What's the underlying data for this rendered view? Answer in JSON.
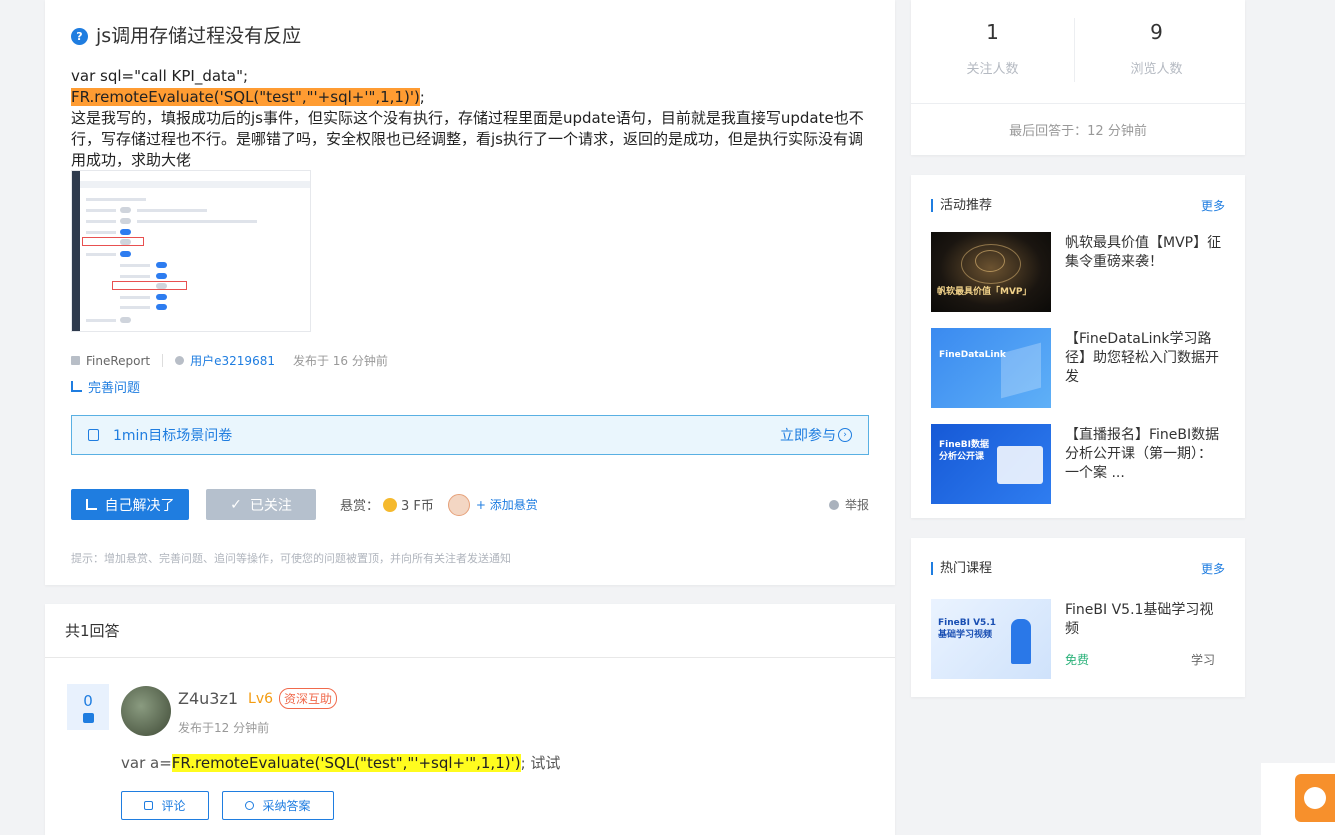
{
  "question": {
    "title": "js调用存储过程没有反应",
    "code_line1": "var sql=\"call KPI_data\";",
    "code_highlight": "FR.remoteEvaluate('SQL(\"test\",\"'+sql+'\",1,1)')",
    "code_suffix": ";",
    "description": "这是我写的，填报成功后的js事件，但实际这个没有执行，存储过程里面是update语句，目前就是我直接写update也不行，写存储过程也不行。是哪错了吗，安全权限也已经调整，看js执行了一个请求，返回的是成功，但是执行实际没有调用成功，求助大佬",
    "tag": "FineReport",
    "author": "用户e3219681",
    "posted": "发布于 16 分钟前",
    "improve_label": "完善问题",
    "survey_label": "1min目标场景问卷",
    "survey_action": "立即参与",
    "solved_label": "自己解决了",
    "followed_label": "已关注",
    "reward_label": "悬赏：",
    "reward_amount": "3 F币",
    "add_reward_label": "+ 添加悬赏",
    "report_label": "举报",
    "tip": "提示：增加悬赏、完善问题、追问等操作，可使您的问题被置顶，并向所有关注者发送通知"
  },
  "answers": {
    "count_label": "共1回答",
    "items": [
      {
        "votes": "0",
        "username": "Z4u3z1",
        "level": "Lv6",
        "badge": "资深互助",
        "posted": "发布于12 分钟前",
        "prefix": "var a=",
        "highlight": "FR.remoteEvaluate('SQL(\"test\",\"'+sql+'\",1,1)')",
        "suffix": "; 试试",
        "comment_label": "评论",
        "accept_label": "采纳答案"
      }
    ]
  },
  "stats": {
    "followers": "1",
    "followers_label": "关注人数",
    "views": "9",
    "views_label": "浏览人数",
    "last_answer": "最后回答于：12 分钟前"
  },
  "activities": {
    "title": "活动推荐",
    "more": "更多",
    "items": [
      {
        "title": "帆软最具价值【MVP】征集令重磅来袭！",
        "thumb_text": "帆软最具价值「MVP」"
      },
      {
        "title": "【FineDataLink学习路径】助您轻松入门数据开发",
        "thumb_text": "FineDataLink"
      },
      {
        "title": "【直播报名】FineBI数据分析公开课（第一期）：一个案 ...",
        "thumb_text": "FineBI数据分析公开课"
      }
    ]
  },
  "courses": {
    "title": "热门课程",
    "more": "更多",
    "items": [
      {
        "title": "FineBI V5.1基础学习视频",
        "price": "免费",
        "action": "学习",
        "thumb_text": "FineBI V5.1 基础学习视频"
      }
    ]
  }
}
